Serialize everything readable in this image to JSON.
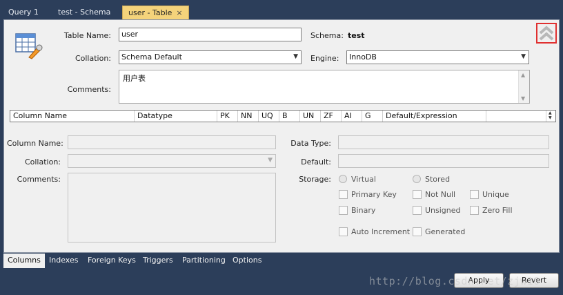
{
  "tabs": [
    {
      "label": "Query 1"
    },
    {
      "label": "test - Schema"
    },
    {
      "label": "user - Table",
      "close": "×"
    }
  ],
  "header": {
    "table_name_label": "Table Name:",
    "table_name_value": "user",
    "schema_label": "Schema:",
    "schema_value": "test",
    "collation_label": "Collation:",
    "collation_value": "Schema Default",
    "engine_label": "Engine:",
    "engine_value": "InnoDB",
    "comments_label": "Comments:",
    "comments_value": "用户表"
  },
  "grid": {
    "columns": [
      "Column Name",
      "Datatype",
      "PK",
      "NN",
      "UQ",
      "B",
      "UN",
      "ZF",
      "AI",
      "G",
      "Default/Expression"
    ]
  },
  "details": {
    "column_name_label": "Column Name:",
    "collation_label": "Collation:",
    "comments_label": "Comments:",
    "data_type_label": "Data Type:",
    "default_label": "Default:",
    "storage_label": "Storage:",
    "virtual_label": "Virtual",
    "stored_label": "Stored",
    "primary_key_label": "Primary Key",
    "not_null_label": "Not Null",
    "unique_label": "Unique",
    "binary_label": "Binary",
    "unsigned_label": "Unsigned",
    "zero_fill_label": "Zero Fill",
    "auto_increment_label": "Auto Increment",
    "generated_label": "Generated"
  },
  "subtabs": [
    "Columns",
    "Indexes",
    "Foreign Keys",
    "Triggers",
    "Partitioning",
    "Options"
  ],
  "buttons": {
    "apply": "Apply",
    "revert": "Revert"
  },
  "watermark": "http://blog.csdn.net/zjw10",
  "colors": {
    "background": "#2c3e5a",
    "active_tab": "#f4d37b",
    "panel": "#f0f0f0",
    "highlight_border": "#e03030"
  }
}
